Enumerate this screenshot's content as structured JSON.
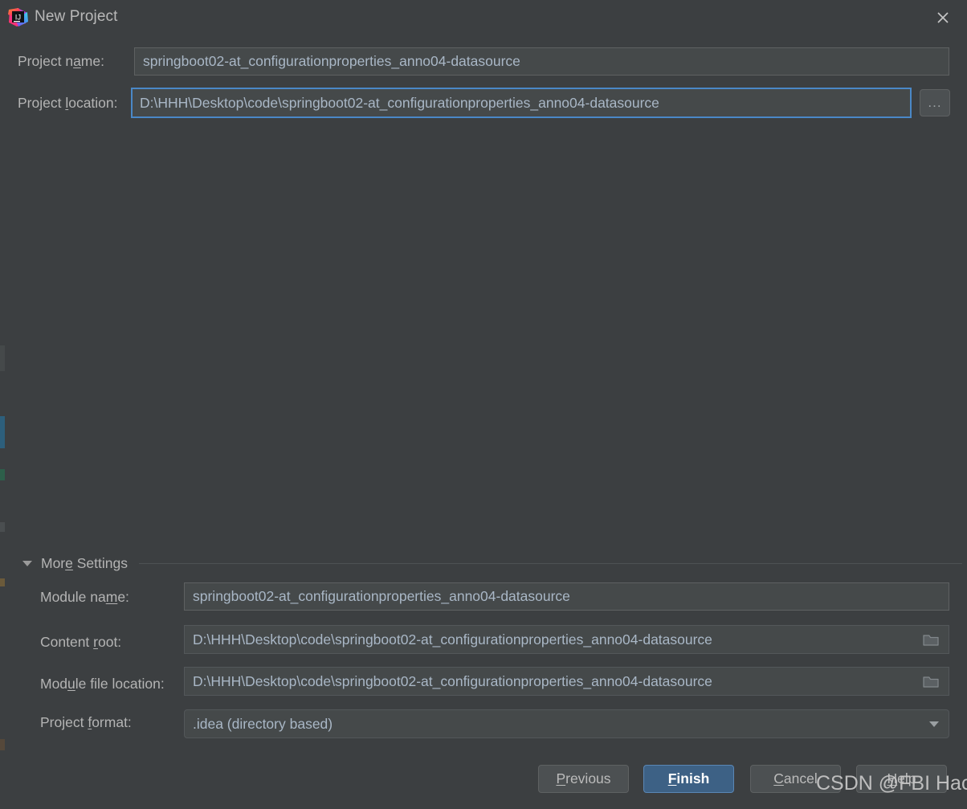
{
  "window": {
    "title": "New Project",
    "logo_icon": "intellij-idea-logo",
    "close_icon": "close-icon"
  },
  "top_form": {
    "project_name": {
      "label_before": "Project n",
      "label_mnemonic": "a",
      "label_after": "me:",
      "value": "springboot02-at_configurationproperties_anno04-datasource"
    },
    "project_location": {
      "label_before": "Project ",
      "label_mnemonic": "l",
      "label_after": "ocation:",
      "value": "D:\\HHH\\Desktop\\code\\springboot02-at_configurationproperties_anno04-datasource",
      "browse_label": "...",
      "browse_icon": "ellipsis-icon"
    }
  },
  "more_settings": {
    "label_before": "Mor",
    "label_mnemonic": "e",
    "label_after": " Settings",
    "expanded": true,
    "triangle_icon": "chevron-down-icon",
    "module_name": {
      "label_before": "Module na",
      "label_mnemonic": "m",
      "label_after": "e:",
      "value": "springboot02-at_configurationproperties_anno04-datasource"
    },
    "content_root": {
      "label_before": "Content ",
      "label_mnemonic": "r",
      "label_after": "oot:",
      "value": "D:\\HHH\\Desktop\\code\\springboot02-at_configurationproperties_anno04-datasource",
      "browse_icon": "folder-icon"
    },
    "module_file_location": {
      "label_before": "Mod",
      "label_mnemonic": "u",
      "label_after": "le file location:",
      "value": "D:\\HHH\\Desktop\\code\\springboot02-at_configurationproperties_anno04-datasource",
      "browse_icon": "folder-icon"
    },
    "project_format": {
      "label_before": "Project ",
      "label_mnemonic": "f",
      "label_after": "ormat:",
      "value": ".idea (directory based)",
      "dropdown_icon": "chevron-down-icon",
      "options": [
        ".idea (directory based)"
      ]
    }
  },
  "footer": {
    "previous": {
      "before": "",
      "mnemonic": "P",
      "after": "revious"
    },
    "finish": {
      "before": "",
      "mnemonic": "F",
      "after": "inish"
    },
    "cancel": {
      "before": "",
      "mnemonic": "C",
      "after": "ancel"
    },
    "help": {
      "before": "",
      "mnemonic": "H",
      "after": "elp"
    }
  },
  "watermark": {
    "text": "CSDN @FBI HackerHarry浩"
  },
  "colors": {
    "dialog_bg": "#3c3f41",
    "field_bg": "#45494a",
    "focus_border": "#4a88c7",
    "primary_button": "#3d6185",
    "text": "#bbbbbb",
    "field_text": "#a9b7c6"
  }
}
